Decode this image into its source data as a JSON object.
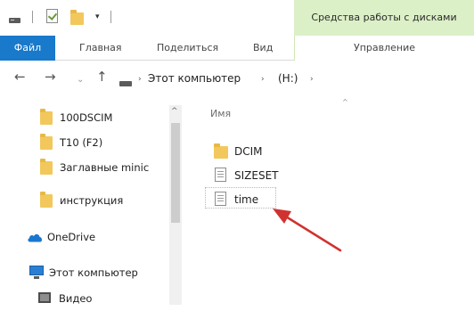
{
  "window": {
    "context_tab": "Средства работы с дисками"
  },
  "ribbon": {
    "tabs": [
      "Файл",
      "Главная",
      "Поделиться",
      "Вид"
    ],
    "manage_tab": "Управление"
  },
  "address": {
    "crumbs": [
      "Этот компьютер",
      "(H:)"
    ]
  },
  "nav_pane": {
    "folders": [
      "100DSCIM",
      "T10 (F2)",
      "Заглавные minic",
      "инструкция"
    ],
    "onedrive": "OneDrive",
    "this_pc": "Этот компьютер",
    "video": "Видео"
  },
  "content": {
    "column_name": "Имя",
    "files": [
      {
        "name": "DCIM",
        "icon": "folder-icon"
      },
      {
        "name": "SIZESET",
        "icon": "document-icon"
      },
      {
        "name": "time",
        "icon": "document-icon"
      }
    ]
  },
  "colors": {
    "file_tab": "#1979ca",
    "context_tab": "#dcf0c7",
    "folder": "#f2c85d",
    "annotation_arrow": "#d0322f"
  },
  "icons": {
    "annotation": "red-arrow-pointer"
  }
}
